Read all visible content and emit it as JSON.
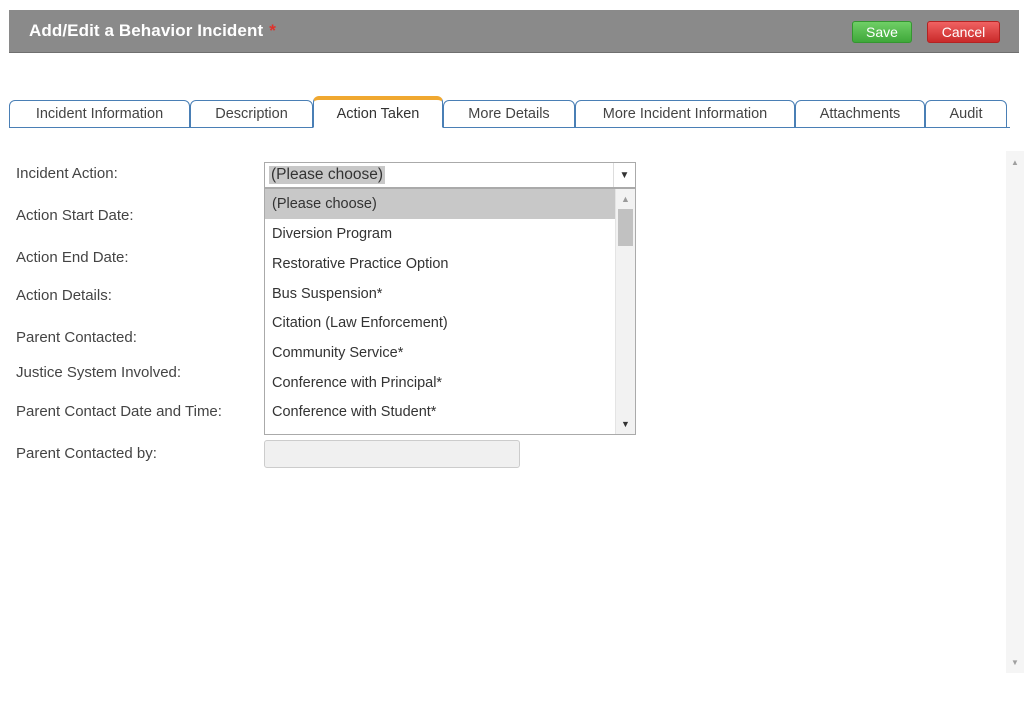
{
  "header": {
    "title": "Add/Edit a Behavior Incident",
    "required_mark": "*",
    "save_label": "Save",
    "cancel_label": "Cancel"
  },
  "tabs": [
    {
      "label": "Incident Information"
    },
    {
      "label": "Description"
    },
    {
      "label": "Action Taken"
    },
    {
      "label": "More Details"
    },
    {
      "label": "More Incident Information"
    },
    {
      "label": "Attachments"
    },
    {
      "label": "Audit"
    }
  ],
  "active_tab": "Action Taken",
  "form": {
    "labels": [
      "Incident Action:",
      "Action Start Date:",
      "Action End Date:",
      "Action Details:",
      "Parent Contacted:",
      "Justice System Involved:",
      "Parent Contact Date and Time:",
      "Parent Contacted by:"
    ],
    "incident_action_value": "(Please choose)",
    "parent_contacted_by_value": ""
  },
  "dropdown": {
    "options": [
      "(Please choose)",
      "Diversion Program",
      "Restorative Practice Option",
      "Bus Suspension*",
      "Citation (Law Enforcement)",
      "Community Service*",
      "Conference with Principal*",
      "Conference with Student*"
    ],
    "selected_index": 0
  },
  "icons": {
    "select_arrow": "caret-down-icon",
    "scroll_up": "scroll-up-arrow-icon",
    "scroll_down": "scroll-down-arrow-icon"
  },
  "colors": {
    "header_bg": "#8a8a8a",
    "save": "#4cb848",
    "cancel": "#d83636",
    "tab_border": "#4a7fb5",
    "active_tab_accent": "#f0a830",
    "required": "#e0302a"
  }
}
